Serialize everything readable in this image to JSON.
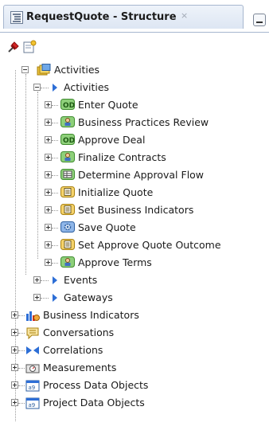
{
  "tab": {
    "title": "RequestQuote - Structure",
    "close_glyph": "×"
  },
  "toolbar": {
    "buttons": [
      {
        "icon": "pin-icon"
      },
      {
        "icon": "new-item-icon"
      }
    ]
  },
  "tree": {
    "activities_root": "Activities",
    "activities": "Activities",
    "activity_items": [
      {
        "label": "Enter Quote",
        "icon": "interactive-task-icon"
      },
      {
        "label": "Business Practices Review",
        "icon": "user-task-icon"
      },
      {
        "label": "Approve Deal",
        "icon": "interactive-task-icon"
      },
      {
        "label": "Finalize Contracts",
        "icon": "user-task-icon"
      },
      {
        "label": "Determine Approval Flow",
        "icon": "business-rule-icon"
      },
      {
        "label": "Initialize Quote",
        "icon": "script-task-icon"
      },
      {
        "label": "Set Business Indicators",
        "icon": "script-task-icon"
      },
      {
        "label": "Save Quote",
        "icon": "service-task-icon"
      },
      {
        "label": "Set Approve Quote Outcome",
        "icon": "script-task-icon"
      },
      {
        "label": "Approve Terms",
        "icon": "user-task-icon"
      }
    ],
    "events": "Events",
    "gateways": "Gateways",
    "root_items": [
      {
        "label": "Business Indicators",
        "icon": "business-indicators-icon"
      },
      {
        "label": "Conversations",
        "icon": "conversations-icon"
      },
      {
        "label": "Correlations",
        "icon": "correlations-icon"
      },
      {
        "label": "Measurements",
        "icon": "measurements-icon"
      },
      {
        "label": "Process Data Objects",
        "icon": "process-data-objects-icon"
      },
      {
        "label": "Project Data Objects",
        "icon": "project-data-objects-icon"
      }
    ]
  },
  "colors": {
    "accent_blue": "#2d6ed6",
    "task_green": "#4aa84a",
    "folder_yellow": "#e8c03a"
  }
}
